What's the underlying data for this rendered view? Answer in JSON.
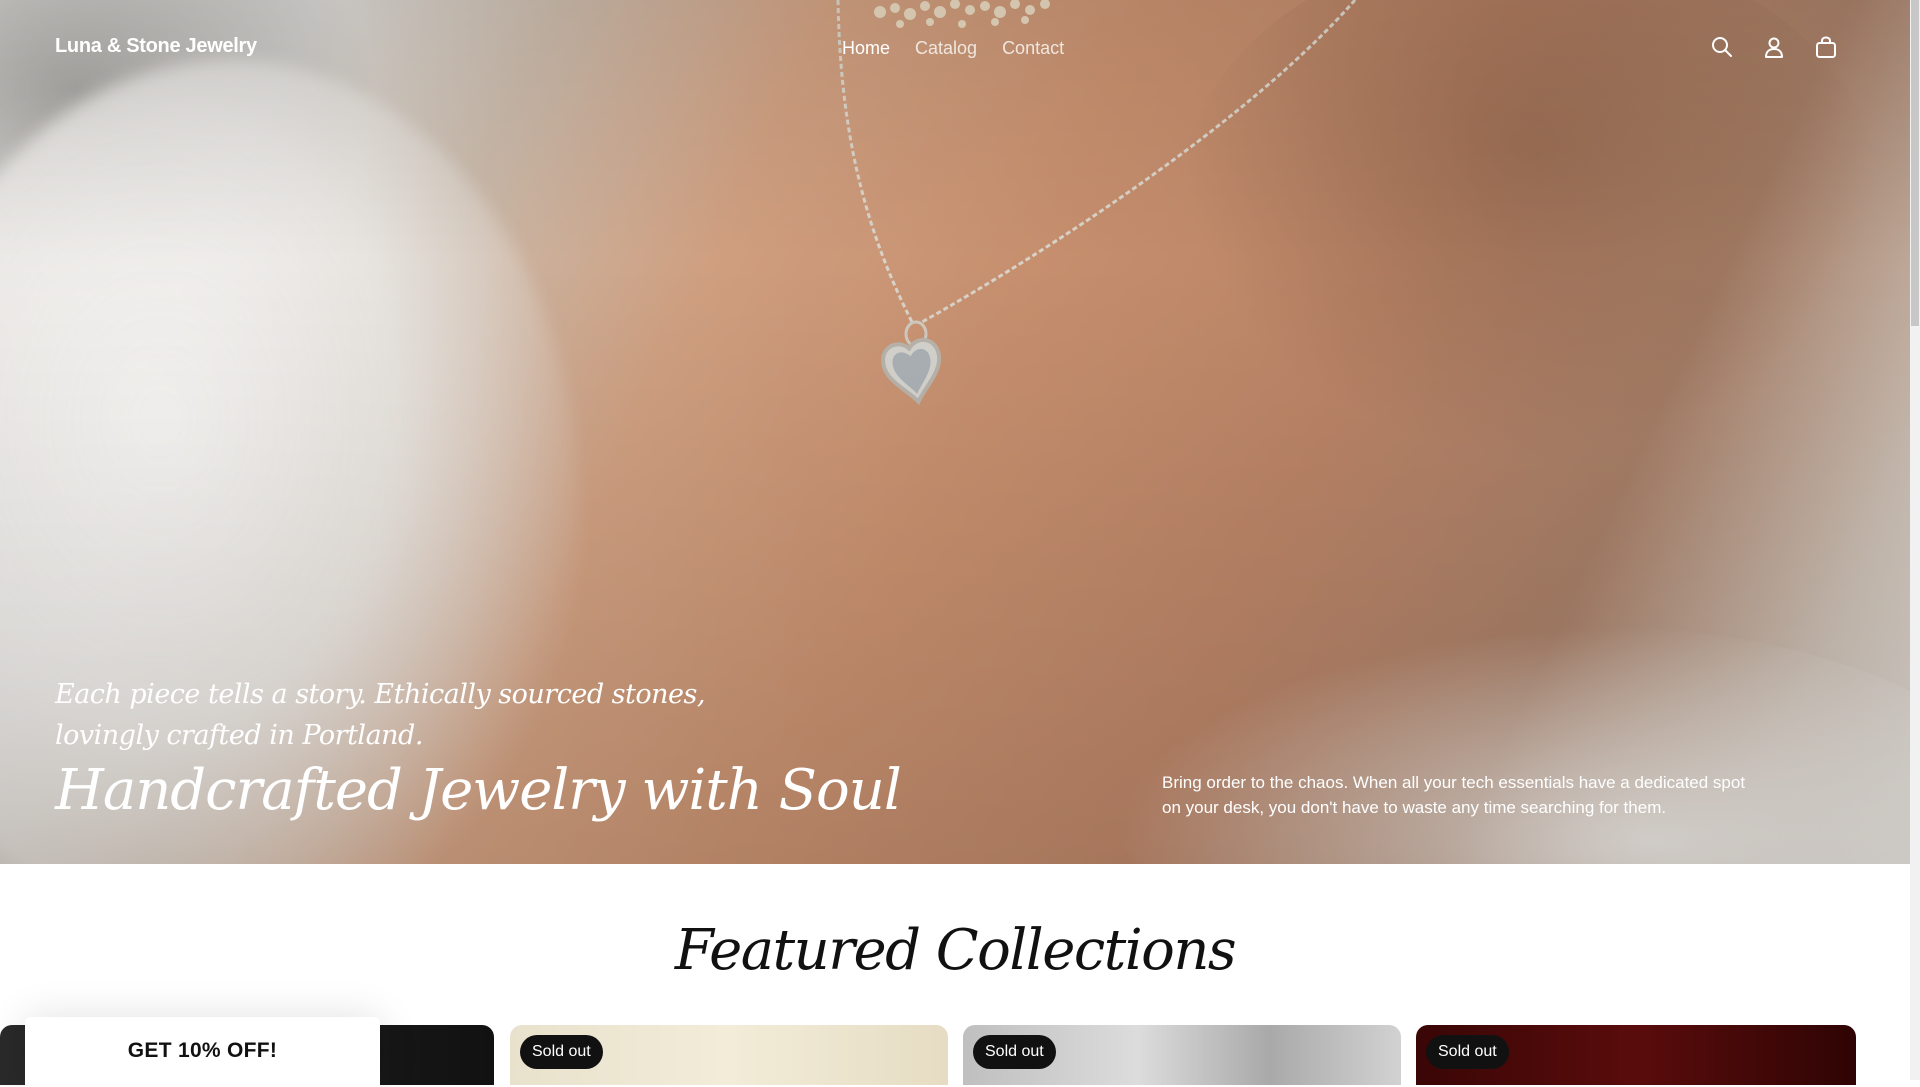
{
  "header": {
    "brand": "Luna & Stone Jewelry",
    "nav": [
      {
        "label": "Home",
        "active": true
      },
      {
        "label": "Catalog",
        "active": false
      },
      {
        "label": "Contact",
        "active": false
      }
    ],
    "icons": [
      "search-icon",
      "account-icon",
      "cart-icon"
    ]
  },
  "hero": {
    "subtitle": "Each piece tells a story. Ethically sourced stones, lovingly crafted in Portland.",
    "title": "Handcrafted Jewelry with Soul",
    "description": "Bring order to the chaos. When all your tech essentials have a dedicated spot on your desk, you don't have to waste any time searching for them."
  },
  "featured": {
    "title": "Featured Collections",
    "cards": [
      {
        "badge": ""
      },
      {
        "badge": "Sold out"
      },
      {
        "badge": "Sold out"
      },
      {
        "badge": "Sold out"
      }
    ]
  },
  "popup": {
    "label": "GET 10% OFF!"
  },
  "colors": {
    "text_dark": "#111111",
    "badge_bg": "#111111",
    "white": "#ffffff"
  }
}
